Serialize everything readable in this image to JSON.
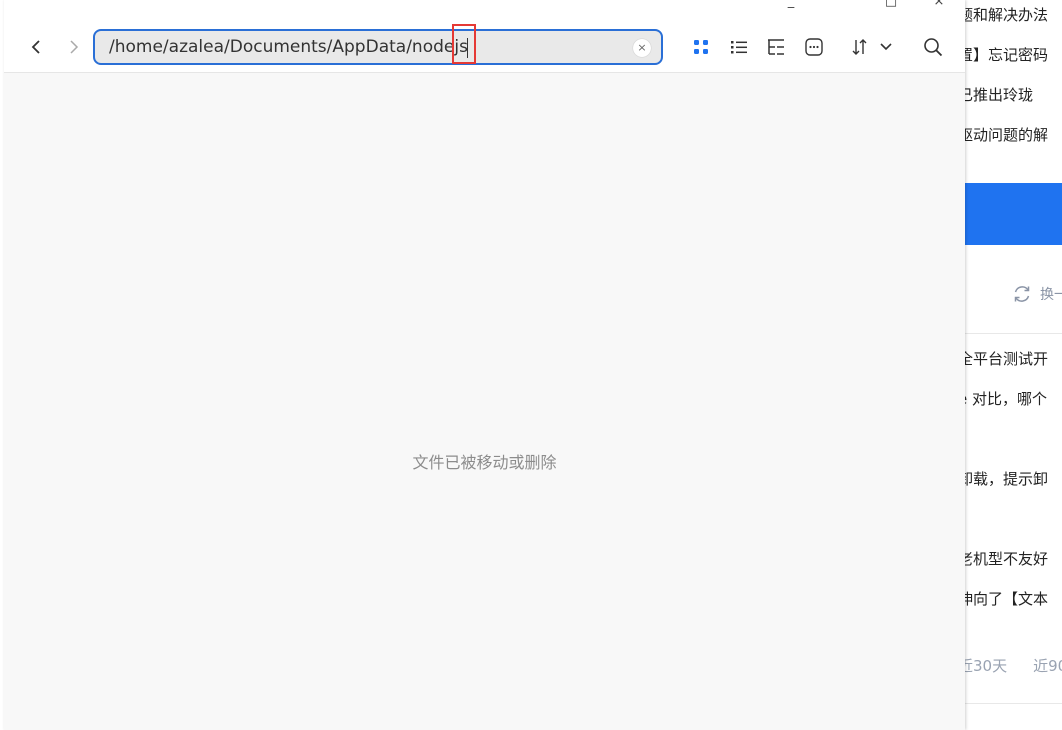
{
  "background_page": {
    "lines": [
      "题和解决办法",
      "置】忘记密码",
      "已推出玲珑",
      "驱动问题的解",
      "全平台测试开",
      "e 对比，哪个",
      "卸载，提示卸",
      "老机型不友好",
      "伸向了【文本"
    ],
    "refresh_label": "换一",
    "filters": [
      "近30天",
      "近90"
    ]
  },
  "window_controls": {
    "menu": "⌃",
    "minimize": "_",
    "maximize": "□",
    "close": "×"
  },
  "address_bar": {
    "path": "/home/azalea/Documents/AppData/nodejs",
    "clear_glyph": "×"
  },
  "toolbar": {
    "icons": [
      "icon-view-icon",
      "list-view-icon",
      "tree-view-icon",
      "more-icon",
      "sort-icon",
      "search-icon"
    ]
  },
  "empty_state": {
    "message": "文件已被移动或删除"
  },
  "colors": {
    "accent": "#2a6fd6",
    "icon_view_active": "#1f73f0",
    "highlight": "#e53935",
    "banner": "#1f73f0"
  }
}
